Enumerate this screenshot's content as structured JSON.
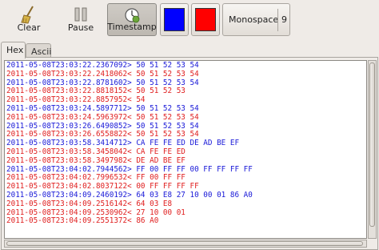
{
  "toolbar": {
    "clear_label": "Clear",
    "pause_label": "Pause",
    "timestamp_label": "Timestamp",
    "timestamp_active": true,
    "color_a": "#0000ff",
    "color_b": "#ff0000",
    "font_name": "Monospace",
    "font_size": "9"
  },
  "tabs": [
    {
      "label": "Hex",
      "active": true
    },
    {
      "label": "Ascii",
      "active": false
    }
  ],
  "colors": {
    "blue": "#1a1ad8",
    "red": "#e02020"
  },
  "log": [
    {
      "text": "2011-05-08T23:03:22.2367092> 50 51 52 53 54",
      "color": "blue"
    },
    {
      "text": "2011-05-08T23:03:22.2418062< 50 51 52 53 54",
      "color": "red"
    },
    {
      "text": "2011-05-08T23:03:22.8781602> 50 51 52 53 54",
      "color": "blue"
    },
    {
      "text": "2011-05-08T23:03:22.8818152< 50 51 52 53",
      "color": "red"
    },
    {
      "text": "2011-05-08T23:03:22.8857952< 54",
      "color": "red"
    },
    {
      "text": "2011-05-08T23:03:24.5897712> 50 51 52 53 54",
      "color": "blue"
    },
    {
      "text": "2011-05-08T23:03:24.5963972< 50 51 52 53 54",
      "color": "red"
    },
    {
      "text": "2011-05-08T23:03:26.6490852> 50 51 52 53 54",
      "color": "blue"
    },
    {
      "text": "2011-05-08T23:03:26.6558822< 50 51 52 53 54",
      "color": "red"
    },
    {
      "text": "2011-05-08T23:03:58.3414712> CA FE FE ED DE AD BE EF",
      "color": "blue"
    },
    {
      "text": "2011-05-08T23:03:58.3458042< CA FE FE ED",
      "color": "red"
    },
    {
      "text": "2011-05-08T23:03:58.3497982< DE AD BE EF",
      "color": "red"
    },
    {
      "text": "2011-05-08T23:04:02.7944562> FF 00 FF FF 00 FF FF FF FF",
      "color": "blue"
    },
    {
      "text": "2011-05-08T23:04:02.7996532< FF 00 FF FF",
      "color": "red"
    },
    {
      "text": "2011-05-08T23:04:02.8037122< 00 FF FF FF FF",
      "color": "red"
    },
    {
      "text": "2011-05-08T23:04:09.2460192> 64 03 E8 27 10 00 01 86 A0",
      "color": "blue"
    },
    {
      "text": "2011-05-08T23:04:09.2516142< 64 03 E8",
      "color": "red"
    },
    {
      "text": "2011-05-08T23:04:09.2530962< 27 10 00 01",
      "color": "red"
    },
    {
      "text": "2011-05-08T23:04:09.2551372< 86 A0",
      "color": "red"
    }
  ]
}
